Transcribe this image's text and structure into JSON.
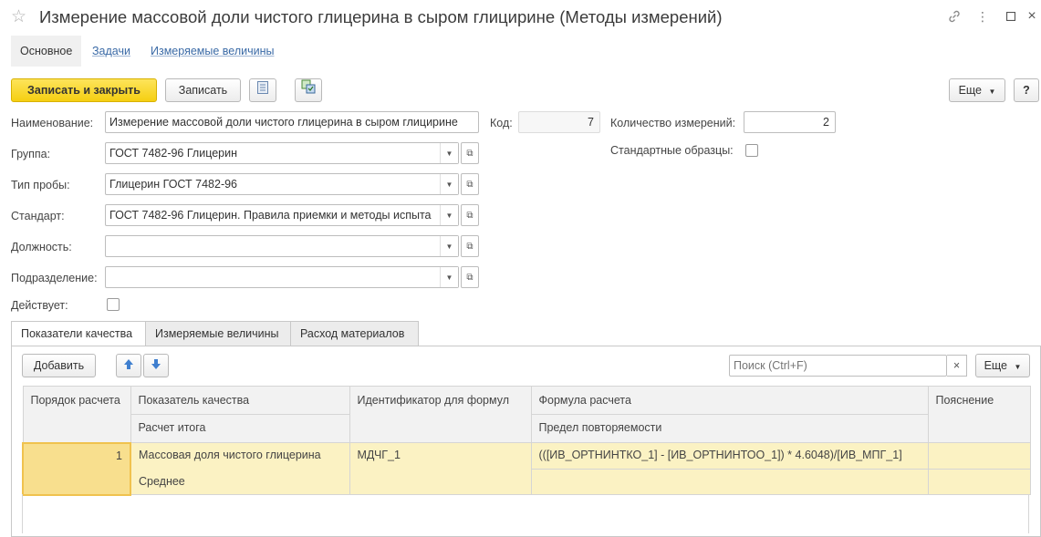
{
  "window": {
    "title": "Измерение массовой доли чистого глицерина в сыром глицирине (Методы измерений)",
    "icons": [
      "star-icon",
      "link-icon",
      "more-icon",
      "maximize-icon",
      "close-icon"
    ]
  },
  "nav_tabs": [
    {
      "label": "Основное",
      "active": true
    },
    {
      "label": "Задачи",
      "active": false
    },
    {
      "label": "Измеряемые величины",
      "active": false
    }
  ],
  "toolbar": {
    "save_close_label": "Записать и закрыть",
    "save_label": "Записать",
    "more_label": "Еще",
    "help_label": "?"
  },
  "form": {
    "name_label": "Наименование:",
    "name_value": "Измерение массовой доли чистого глицерина в сыром глицирине",
    "code_label": "Код:",
    "code_value": "7",
    "count_label": "Количество измерений:",
    "count_value": "2",
    "std_samples_label": "Стандартные образцы:",
    "group_label": "Группа:",
    "group_value": "ГОСТ 7482-96 Глицерин",
    "sample_type_label": "Тип пробы:",
    "sample_type_value": "Глицерин ГОСТ 7482-96",
    "standard_label": "Стандарт:",
    "standard_value": "ГОСТ 7482-96 Глицерин. Правила приемки и методы испыта",
    "position_label": "Должность:",
    "position_value": "",
    "department_label": "Подразделение:",
    "department_value": "",
    "active_label": "Действует:"
  },
  "tabs": [
    {
      "label": "Показатели качества",
      "active": true
    },
    {
      "label": "Измеряемые величины",
      "active": false
    },
    {
      "label": "Расход материалов",
      "active": false
    }
  ],
  "table_toolbar": {
    "add_label": "Добавить",
    "search_placeholder": "Поиск (Ctrl+F)",
    "clear_label": "×",
    "more_label": "Еще"
  },
  "table": {
    "headers": {
      "order": "Порядок расчета",
      "indicator": "Показатель качества",
      "total_calc": "Расчет итога",
      "identifier": "Идентификатор для формул",
      "formula": "Формула расчета",
      "repeat_limit": "Предел повторяемости",
      "note": "Пояснение"
    },
    "rows": [
      {
        "order": "1",
        "indicator": "Массовая доля чистого глицерина",
        "total_calc": "Среднее",
        "identifier": "МДЧГ_1",
        "formula": "(([ИВ_ОРТНИНТКО_1]  -  [ИВ_ОРТНИНТОО_1]) * 4.6048)/[ИВ_МПГ_1]",
        "repeat_limit": "",
        "note": ""
      }
    ]
  },
  "colors": {
    "accent": "#f5cf11",
    "selected_row": "#fbf2c3",
    "current_cell": "#f8df8e",
    "link": "#3a6aa6"
  }
}
